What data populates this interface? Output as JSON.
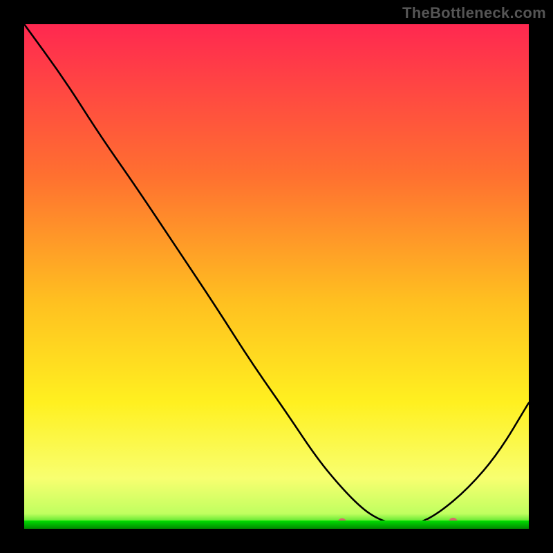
{
  "watermark": "TheBottleneck.com",
  "chart_data": {
    "type": "line",
    "x": [
      0,
      8,
      15,
      22,
      30,
      38,
      45,
      52,
      58,
      63,
      67,
      70,
      73,
      75,
      78,
      82,
      88,
      94,
      100
    ],
    "values": [
      100,
      89,
      78,
      68,
      56,
      44,
      33,
      23,
      14,
      8,
      4,
      2,
      1,
      0.5,
      1,
      3,
      8,
      15,
      25
    ],
    "optimal_markers_x": [
      63,
      66,
      68,
      70,
      72,
      74,
      76,
      78,
      80,
      85
    ],
    "optimal_markers_y": [
      1.2,
      0.8,
      0.6,
      0.5,
      0.4,
      0.4,
      0.5,
      0.7,
      0.9,
      1.3
    ],
    "title": "",
    "xlabel": "",
    "ylabel": "",
    "xlim": [
      0,
      100
    ],
    "ylim": [
      0,
      100
    ],
    "gradient_stops": [
      {
        "offset": 0,
        "color": "#ff2850"
      },
      {
        "offset": 30,
        "color": "#ff7030"
      },
      {
        "offset": 55,
        "color": "#ffc020"
      },
      {
        "offset": 75,
        "color": "#fff020"
      },
      {
        "offset": 90,
        "color": "#f8ff70"
      },
      {
        "offset": 97,
        "color": "#c0ff60"
      },
      {
        "offset": 100,
        "color": "#00d000"
      }
    ]
  }
}
